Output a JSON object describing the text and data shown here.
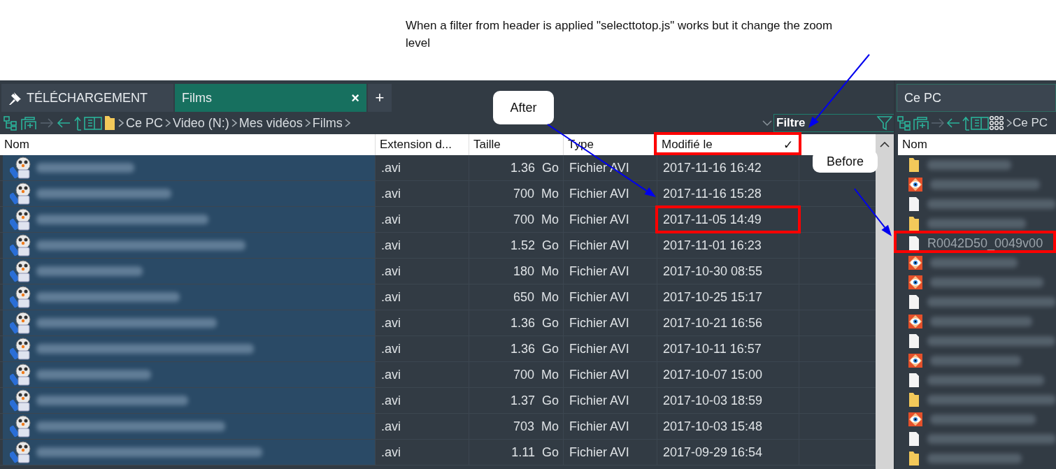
{
  "annotation": {
    "note": "When a filter from header is applied \"selecttotop.js\" works but it change the zoom level",
    "callouts": [
      {
        "text": "After"
      },
      {
        "text": "Before"
      }
    ]
  },
  "left_pane": {
    "tabs": [
      {
        "label": "TÉLÉCHARGEMENT",
        "pinned": true,
        "selected": false
      },
      {
        "label": "Films",
        "pinned": false,
        "selected": true,
        "close": "×"
      }
    ],
    "new_tab": "+",
    "breadcrumb": [
      "Ce PC",
      "Video (N:)",
      "Mes vidéos",
      "Films"
    ],
    "filter": {
      "placeholder": "Filtre"
    },
    "columns": [
      {
        "label": "Nom"
      },
      {
        "label": "Extension d..."
      },
      {
        "label": "Taille"
      },
      {
        "label": "Type"
      },
      {
        "label": "Modifié le",
        "filter_mark": "✓"
      }
    ],
    "rows": [
      {
        "selected": true,
        "ext": ".avi",
        "size": "1.36",
        "unit": "Go",
        "type": "Fichier AVI",
        "modified": "2017-11-16 16:42"
      },
      {
        "selected": true,
        "ext": ".avi",
        "size": "700",
        "unit": "Mo",
        "type": "Fichier AVI",
        "modified": "2017-11-16 15:28"
      },
      {
        "selected": true,
        "ext": ".avi",
        "size": "700",
        "unit": "Mo",
        "type": "Fichier AVI",
        "modified": "2017-11-05 14:49"
      },
      {
        "selected": true,
        "ext": ".avi",
        "size": "1.52",
        "unit": "Go",
        "type": "Fichier AVI",
        "modified": "2017-11-01 16:23"
      },
      {
        "selected": true,
        "ext": ".avi",
        "size": "180",
        "unit": "Mo",
        "type": "Fichier AVI",
        "modified": "2017-10-30 08:55"
      },
      {
        "selected": true,
        "ext": ".avi",
        "size": "650",
        "unit": "Mo",
        "type": "Fichier AVI",
        "modified": "2017-10-25 15:17"
      },
      {
        "selected": true,
        "ext": ".avi",
        "size": "1.36",
        "unit": "Go",
        "type": "Fichier AVI",
        "modified": "2017-10-21 16:56"
      },
      {
        "selected": true,
        "ext": ".avi",
        "size": "1.36",
        "unit": "Go",
        "type": "Fichier AVI",
        "modified": "2017-10-11 16:57"
      },
      {
        "selected": true,
        "ext": ".avi",
        "size": "700",
        "unit": "Mo",
        "type": "Fichier AVI",
        "modified": "2017-10-07 15:00"
      },
      {
        "selected": true,
        "ext": ".avi",
        "size": "1.37",
        "unit": "Go",
        "type": "Fichier AVI",
        "modified": "2017-10-03 18:59"
      },
      {
        "selected": true,
        "ext": ".avi",
        "size": "703",
        "unit": "Mo",
        "type": "Fichier AVI",
        "modified": "2017-10-03 15:48"
      },
      {
        "selected": true,
        "ext": ".avi",
        "size": "1.11",
        "unit": "Go",
        "type": "Fichier AVI",
        "modified": "2017-09-29 16:54"
      }
    ]
  },
  "right_pane": {
    "tab": {
      "label": "Ce PC"
    },
    "breadcrumb": [
      "Ce PC"
    ],
    "columns": [
      {
        "label": "Nom"
      }
    ],
    "rows": [
      {
        "kind": "folder"
      },
      {
        "kind": "image"
      },
      {
        "kind": "file"
      },
      {
        "kind": "folder"
      },
      {
        "kind": "file",
        "name": "R0042D50_0049v00"
      },
      {
        "kind": "image"
      },
      {
        "kind": "image"
      },
      {
        "kind": "file"
      },
      {
        "kind": "image"
      },
      {
        "kind": "file"
      },
      {
        "kind": "image"
      },
      {
        "kind": "file"
      },
      {
        "kind": "folder"
      },
      {
        "kind": "image"
      },
      {
        "kind": "file"
      },
      {
        "kind": "folder"
      }
    ]
  }
}
